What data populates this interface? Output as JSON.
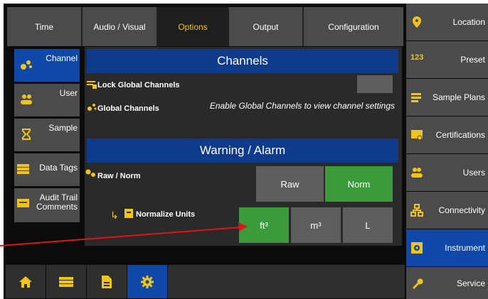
{
  "tabs": [
    {
      "label": "Time",
      "active": false
    },
    {
      "label": "Audio / Visual",
      "active": false
    },
    {
      "label": "Options",
      "active": true
    },
    {
      "label": "Output",
      "active": false
    },
    {
      "label": "Configuration",
      "active": false
    }
  ],
  "left_menu": [
    {
      "label": "Channel",
      "icon": "channel-icon",
      "active": true
    },
    {
      "label": "User",
      "icon": "users-icon",
      "active": false
    },
    {
      "label": "Sample",
      "icon": "hourglass-icon",
      "active": false
    },
    {
      "label": "Data Tags",
      "icon": "list-icon",
      "active": false
    },
    {
      "label": "Audit Trail Comments",
      "icon": "comment-icon",
      "active": false
    }
  ],
  "channels": {
    "title": "Channels",
    "lock_label": "Lock Global Channels",
    "global_label": "Global Channels",
    "global_msg": "Enable Global Channels to view channel settings"
  },
  "warning": {
    "title": "Warning / Alarm",
    "raw_norm_label": "Raw / Norm",
    "raw_btn": "Raw",
    "norm_btn": "Norm",
    "normalize_label": "Normalize Units",
    "unit_ft": "ft³",
    "unit_m": "m³",
    "unit_l": "L"
  },
  "right_menu": [
    {
      "label": "Location",
      "icon": "location-icon",
      "active": false
    },
    {
      "label": "Preset",
      "icon": "preset-123-icon",
      "active": false
    },
    {
      "label": "Sample Plans",
      "icon": "sample-plans-icon",
      "active": false
    },
    {
      "label": "Certifications",
      "icon": "certification-icon",
      "active": false
    },
    {
      "label": "Users",
      "icon": "users-icon",
      "active": false
    },
    {
      "label": "Connectivity",
      "icon": "connectivity-icon",
      "active": false
    },
    {
      "label": "Instrument",
      "icon": "instrument-gear-icon",
      "active": true
    },
    {
      "label": "Service",
      "icon": "wrench-icon",
      "active": false
    }
  ],
  "bottom_nav": [
    {
      "icon": "home-icon",
      "active": false
    },
    {
      "icon": "list-icon",
      "active": false
    },
    {
      "icon": "document-icon",
      "active": false
    },
    {
      "icon": "settings-gear-icon",
      "active": true
    }
  ],
  "colors": {
    "accent_blue": "#0f48a8",
    "header_blue": "#0f3b8c",
    "active_green": "#3b9b3b",
    "icon_yellow": "#f0c419",
    "annotation_red": "#e01515"
  }
}
